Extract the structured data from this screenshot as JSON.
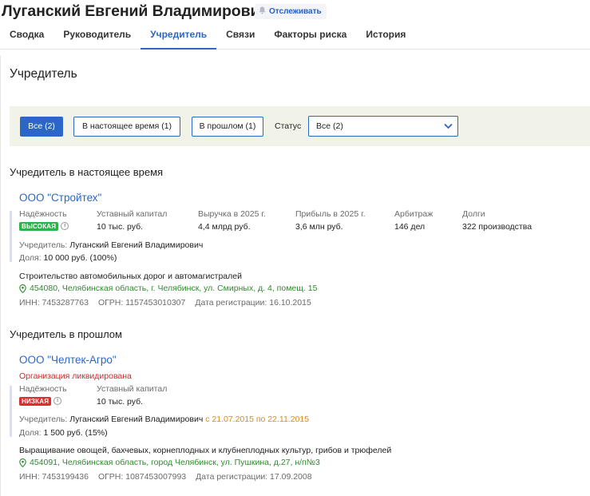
{
  "header": {
    "person_name": "Луганский Евгений Владимирович",
    "track_label": "Отслеживать",
    "tabs": [
      {
        "label": "Сводка"
      },
      {
        "label": "Руководитель"
      },
      {
        "label": "Учредитель",
        "active": true
      },
      {
        "label": "Связи"
      },
      {
        "label": "Факторы риска"
      },
      {
        "label": "История"
      }
    ]
  },
  "section_title": "Учредитель",
  "filters": {
    "all": "Все (2)",
    "current": "В настоящее время (1)",
    "past": "В прошлом (1)",
    "status_label": "Статус",
    "status_value": "Все (2)"
  },
  "current_group": {
    "title": "Учредитель в настоящее время",
    "company": {
      "name": "ООО \"Стройтех\"",
      "labels": {
        "reliability": "Надёжность",
        "capital": "Уставный капитал",
        "revenue": "Выручка в 2025 г.",
        "profit": "Прибыль в 2025 г.",
        "arbitration": "Арбитраж",
        "debts": "Долги"
      },
      "reliability_badge": "ВЫСОКАЯ",
      "capital": "10 тыс. руб.",
      "revenue": "4,4 млрд руб.",
      "profit": "3,6 млн руб.",
      "arbitration": "146 дел",
      "debts": "322 производства",
      "founder_label": "Учредитель:",
      "founder_name": "Луганский Евгений Владимирович",
      "share_label": "Доля:",
      "share_value": "10 000 руб. (100%)",
      "activity": "Строительство автомобильных дорог и автомагистралей",
      "address": "454080, Челябинская область, г. Челябинск, ул. Смирных, д. 4, помещ. 15",
      "inn": "ИНН: 7453287763",
      "ogrn": "ОГРН: 1157453010307",
      "reg_date": "Дата регистрации: 16.10.2015"
    }
  },
  "past_group": {
    "title": "Учредитель в прошлом",
    "company": {
      "name": "ООО \"Челтек-Агро\"",
      "status": "Организация ликвидирована",
      "labels": {
        "reliability": "Надёжность",
        "capital": "Уставный капитал"
      },
      "reliability_badge": "НИЗКАЯ",
      "capital": "10 тыс. руб.",
      "founder_label": "Учредитель:",
      "founder_name": "Луганский Евгений Владимирович",
      "founder_period": "с 21.07.2015 по 22.11.2015",
      "share_label": "Доля:",
      "share_value": "1 500 руб. (15%)",
      "activity": "Выращивание овощей, бахчевых, корнеплодных и клубнеплодных культур, грибов и трюфелей",
      "address": "454091, Челябинская область, город Челябинск, ул. Пушкина, д.27, н/п№3",
      "inn": "ИНН: 7453199436",
      "ogrn": "ОГРН: 1087453007993",
      "reg_date": "Дата регистрации: 17.09.2008"
    }
  },
  "colors": {
    "accent": "#2a67c7",
    "badge_high": "#2eb24a",
    "badge_low": "#d9302f",
    "address": "#2e8b2e",
    "period": "#d98a1e",
    "liquidated": "#d4262c",
    "filter_bg": "#f2f3e8"
  },
  "icons": [
    "bell-icon",
    "chevron-down-icon",
    "info-icon",
    "location-pin-icon"
  ]
}
